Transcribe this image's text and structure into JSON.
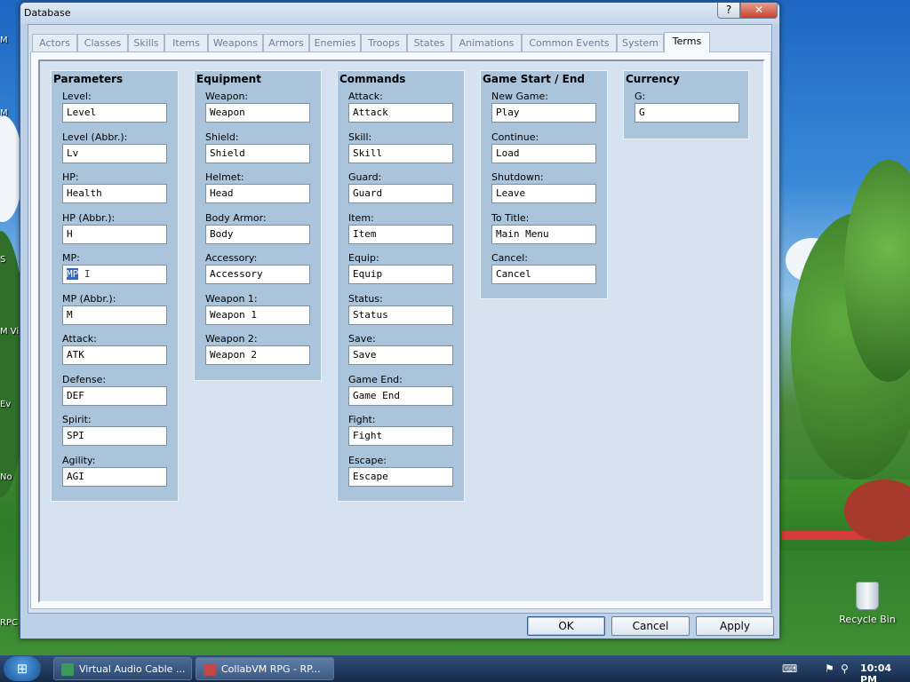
{
  "window": {
    "title": "Database",
    "help_label": "?",
    "close_label": "✕"
  },
  "tabs": [
    {
      "label": "Actors"
    },
    {
      "label": "Classes"
    },
    {
      "label": "Skills"
    },
    {
      "label": "Items"
    },
    {
      "label": "Weapons"
    },
    {
      "label": "Armors"
    },
    {
      "label": "Enemies"
    },
    {
      "label": "Troops"
    },
    {
      "label": "States"
    },
    {
      "label": "Animations"
    },
    {
      "label": "Common Events"
    },
    {
      "label": "System"
    },
    {
      "label": "Terms",
      "active": true
    }
  ],
  "groups": {
    "parameters": {
      "title": "Parameters",
      "fields": [
        {
          "label": "Level:",
          "value": "Level"
        },
        {
          "label": "Level (Abbr.):",
          "value": "Lv"
        },
        {
          "label": "HP:",
          "value": "Health"
        },
        {
          "label": "HP (Abbr.):",
          "value": "H"
        },
        {
          "label": "MP:",
          "value": "MP",
          "selected": true
        },
        {
          "label": "MP (Abbr.):",
          "value": "M"
        },
        {
          "label": "Attack:",
          "value": "ATK"
        },
        {
          "label": "Defense:",
          "value": "DEF"
        },
        {
          "label": "Spirit:",
          "value": "SPI"
        },
        {
          "label": "Agility:",
          "value": "AGI"
        }
      ]
    },
    "equipment": {
      "title": "Equipment",
      "fields": [
        {
          "label": "Weapon:",
          "value": "Weapon"
        },
        {
          "label": "Shield:",
          "value": "Shield"
        },
        {
          "label": "Helmet:",
          "value": "Head"
        },
        {
          "label": "Body Armor:",
          "value": "Body"
        },
        {
          "label": "Accessory:",
          "value": "Accessory"
        },
        {
          "label": "Weapon 1:",
          "value": "Weapon 1"
        },
        {
          "label": "Weapon 2:",
          "value": "Weapon 2"
        }
      ]
    },
    "commands": {
      "title": "Commands",
      "fields": [
        {
          "label": "Attack:",
          "value": "Attack"
        },
        {
          "label": "Skill:",
          "value": "Skill"
        },
        {
          "label": "Guard:",
          "value": "Guard"
        },
        {
          "label": "Item:",
          "value": "Item"
        },
        {
          "label": "Equip:",
          "value": "Equip"
        },
        {
          "label": "Status:",
          "value": "Status"
        },
        {
          "label": "Save:",
          "value": "Save"
        },
        {
          "label": "Game End:",
          "value": "Game End"
        },
        {
          "label": "Fight:",
          "value": "Fight"
        },
        {
          "label": "Escape:",
          "value": "Escape"
        }
      ]
    },
    "game_start_end": {
      "title": "Game Start / End",
      "fields": [
        {
          "label": "New Game:",
          "value": "Play"
        },
        {
          "label": "Continue:",
          "value": "Load"
        },
        {
          "label": "Shutdown:",
          "value": "Leave"
        },
        {
          "label": "To Title:",
          "value": "Main Menu"
        },
        {
          "label": "Cancel:",
          "value": "Cancel"
        }
      ]
    },
    "currency": {
      "title": "Currency",
      "fields": [
        {
          "label": "G:",
          "value": "G"
        }
      ]
    }
  },
  "buttons": {
    "ok": "OK",
    "cancel": "Cancel",
    "apply": "Apply"
  },
  "desktop": {
    "recycle_bin_label": "Recycle Bin",
    "left_icons": [
      "M",
      "M",
      "S",
      "M Vis",
      "Ev",
      "No",
      "RPC"
    ]
  },
  "taskbar": {
    "items": [
      {
        "label": "Virtual Audio Cable ..."
      },
      {
        "label": "CollabVM RPG - RP..."
      }
    ],
    "clock": "10:04 PM"
  }
}
